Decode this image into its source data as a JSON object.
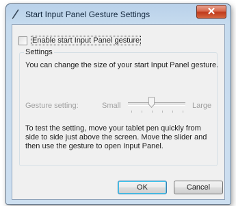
{
  "window": {
    "title": "Start Input Panel Gesture Settings",
    "title_icon": "pen-icon",
    "close_icon": "close-x-icon"
  },
  "enable_checkbox": {
    "label": "Enable start Input Panel gesture",
    "checked": false
  },
  "settings_group": {
    "legend": "Settings",
    "description": "You can change the size of your start Input Panel gesture.",
    "gesture_label": "Gesture setting:",
    "slider_min_label": "Small",
    "slider_max_label": "Large",
    "slider_value": 0.4,
    "slider_tick_count": 6,
    "slider_enabled": false,
    "hint": "To test the setting, move your tablet pen quickly from side to side just above the screen.  Move the slider and then use the gesture to open Input Panel."
  },
  "buttons": {
    "ok": "OK",
    "cancel": "Cancel"
  },
  "colors": {
    "close_button": "#c73b1c",
    "title_bar": "#c6dbee",
    "client_bg": "#f0f0f0",
    "disabled_text": "#a0a0a0"
  }
}
